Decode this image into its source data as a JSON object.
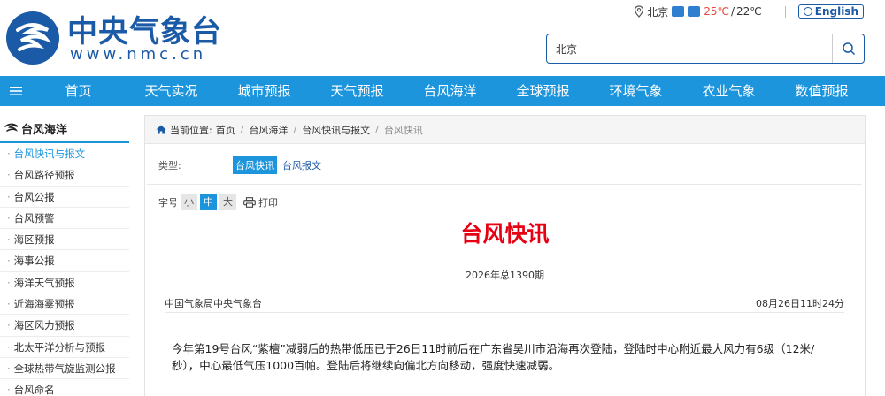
{
  "header": {
    "brand_cn": "中央气象台",
    "brand_en": "www.nmc.cn",
    "weather": {
      "city": "北京",
      "temp_high": "25℃",
      "temp_sep": "/",
      "temp_low": "22℃"
    },
    "lang_button": "English",
    "search": {
      "value": "北京"
    },
    "colors": {
      "brand": "#1a5aa6",
      "nav": "#1d95dd",
      "accent_red": "#e60012"
    }
  },
  "nav": {
    "items": [
      "首页",
      "天气实况",
      "城市预报",
      "天气预报",
      "台风海洋",
      "全球预报",
      "环境气象",
      "农业气象",
      "数值预报"
    ]
  },
  "sidebar": {
    "title": "台风海洋",
    "items": [
      "台风快讯与报文",
      "台风路径预报",
      "台风公报",
      "台风预警",
      "海区预报",
      "海事公报",
      "海洋天气预报",
      "近海海雾预报",
      "海区风力预报",
      "北太平洋分析与预报",
      "全球热带气旋监测公报",
      "台风命名"
    ],
    "active_index": 0
  },
  "breadcrumb": {
    "label": "当前位置:",
    "items": [
      "首页",
      "台风海洋",
      "台风快讯与报文",
      "台风快讯"
    ],
    "sep": "/"
  },
  "type_row": {
    "label": "类型:",
    "tags": [
      "台风快讯",
      "台风报文"
    ]
  },
  "font_size": {
    "label": "字号",
    "options": [
      "小",
      "中",
      "大"
    ],
    "active": "中",
    "print_label": "打印"
  },
  "article": {
    "title": "台风快讯",
    "issue": "2026年总1390期",
    "source": "中国气象局中央气象台",
    "time": "08月26日11时24分",
    "body": "今年第19号台风“紫檀”减弱后的热带低压已于26日11时前后在广东省吴川市沿海再次登陆，登陆时中心附近最大风力有6级（12米/秒），中心最低气压1000百帕。登陆后将继续向偏北方向移动，强度快速减弱。"
  }
}
